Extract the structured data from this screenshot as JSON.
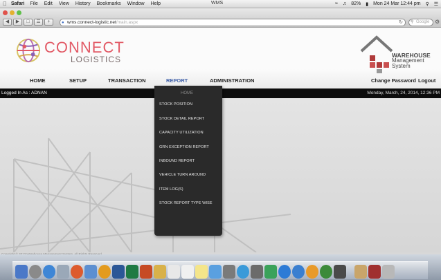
{
  "os_menu": {
    "app": "Safari",
    "items": [
      "File",
      "Edit",
      "View",
      "History",
      "Bookmarks",
      "Window",
      "Help"
    ],
    "window_title": "WMS",
    "battery": "82%",
    "clock": "Mon 24 Mar  12:44 pm"
  },
  "browser": {
    "url_domain": "wms.connect-logistic.net",
    "url_path": "/main.aspx",
    "search_placeholder": "Google"
  },
  "brand": {
    "line1": "CONNECT",
    "line2": "LOGISTICS"
  },
  "wms_logo": {
    "line1": "WAREHOUSE",
    "line2": "Management",
    "line3": "System"
  },
  "nav": {
    "home": "HOME",
    "setup": "SETUP",
    "transaction": "TRANSACTION",
    "report": "REPORT",
    "administration": "ADMINISTRATION",
    "change_password": "Change Password",
    "logout": "Logout"
  },
  "status": {
    "logged_in": "Logged In As : ADNAN",
    "datetime": "Monday, March, 24, 2014, 12:36 PM"
  },
  "report_menu": {
    "home": "HOME",
    "items": [
      "STOCK POSITION",
      "STOCK DETAIL REPORT",
      "CAPACITY UTILIZATION",
      "GRN EXCEPTION REPORT",
      "INBOUND REPORT",
      "VEHICLE TURN AROUND",
      "ITEM LOG(S)",
      "STOCK REPORT TYPE WISE"
    ]
  },
  "footer": {
    "copyright": "Copyright © 2013 Warehouse Management System. All Rights Reserved."
  },
  "colors": {
    "brand_red": "#e25a66",
    "active_nav": "#3d5ea8",
    "bar_black": "#0d0d0d"
  }
}
